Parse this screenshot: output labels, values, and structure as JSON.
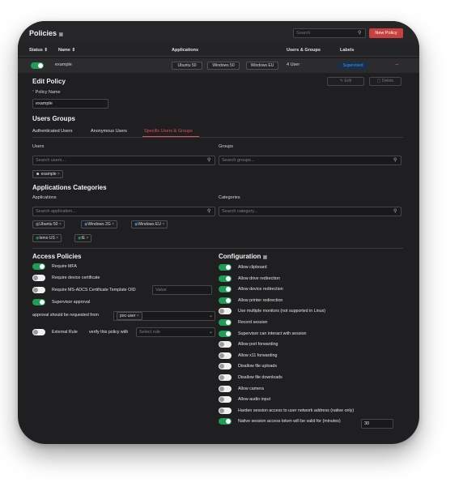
{
  "header": {
    "title": "Policies",
    "search_placeholder": "Search",
    "new_button": "New Policy"
  },
  "table": {
    "columns": [
      "Status",
      "Name",
      "Applications",
      "Users & Groups",
      "Labels"
    ],
    "row": {
      "name": "example",
      "apps": [
        "Ubuntu 50",
        "Windows 50",
        "Windows EU"
      ],
      "users": "4 User",
      "label": "Supervised",
      "remove": "−"
    }
  },
  "edit": {
    "title": "Edit Policy",
    "edit_btn": "Edit",
    "delete_btn": "Delete",
    "policy_name_label": "Policy Name",
    "policy_name": "example",
    "users_groups_title": "Users Groups",
    "tabs": [
      "Authenticated Users",
      "Anonymous Users",
      "Specific Users & Groups"
    ],
    "users_label": "Users",
    "users_placeholder": "Search users...",
    "user_tag": "example",
    "groups_label": "Groups",
    "groups_placeholder": "Search groups...",
    "app_cat_title": "Applications Categories",
    "apps_label": "Applications",
    "apps_placeholder": "Search application...",
    "app_tags": [
      "Ubuntu 50",
      "Windows 2G",
      "Windows EU",
      "Iemo US",
      "IE"
    ],
    "cat_label": "Categories",
    "cat_placeholder": "Search category..."
  },
  "access": {
    "title": "Access Policies",
    "items": [
      {
        "label": "Require MFA",
        "on": true
      },
      {
        "label": "Require device certificate",
        "on": false
      },
      {
        "label": "Require MS-ADCS Certificate Template OID",
        "on": false
      },
      {
        "label": "Supervisor approval",
        "on": true
      }
    ],
    "oid_placeholder": "Value",
    "approval_label": "approval should be requested from",
    "approval_value": "poc-user",
    "external_label": "External Rule",
    "verify_label": "verify this policy with",
    "select_placeholder": "Select rule"
  },
  "config": {
    "title": "Configuration",
    "items": [
      {
        "label": "Allow clipboard",
        "on": true
      },
      {
        "label": "Allow drive redirection",
        "on": true
      },
      {
        "label": "Allow device redirection",
        "on": true
      },
      {
        "label": "Allow printer redirection",
        "on": true
      },
      {
        "label": "Use multiple monitors (not supported in Linux)",
        "on": false
      },
      {
        "label": "Record session",
        "on": true
      },
      {
        "label": "Supervisor can interact with session",
        "on": true
      },
      {
        "label": "Allow port forwarding",
        "on": false
      },
      {
        "label": "Allow x11 forwarding",
        "on": false
      },
      {
        "label": "Disallow file uploads",
        "on": false
      },
      {
        "label": "Disallow file downloads",
        "on": false
      },
      {
        "label": "Allow camera",
        "on": false
      },
      {
        "label": "Allow audio input",
        "on": false
      },
      {
        "label": "Harden session access to user network address (native only)",
        "on": false
      },
      {
        "label": "Native session access token will be valid for (minutes)",
        "on": true
      }
    ],
    "token_minutes": "30"
  },
  "colors": {
    "accent": "#c8413f",
    "toggle_on": "#1f9d55",
    "tab_active": "#e0534f",
    "label_badge": "#4d8fd6"
  }
}
